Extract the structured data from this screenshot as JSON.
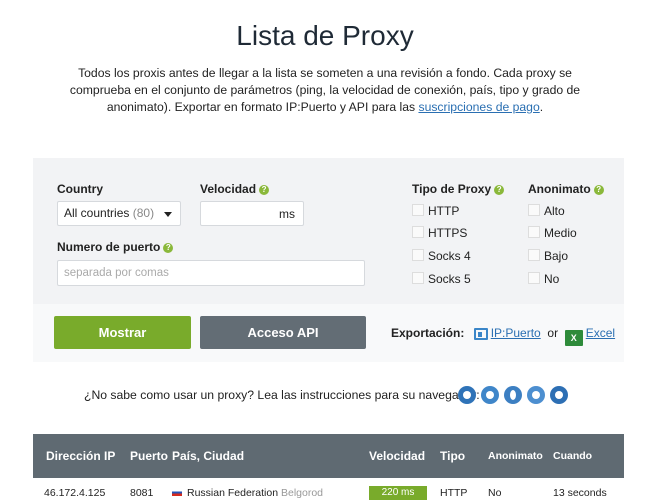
{
  "page": {
    "title": "Lista de Proxy",
    "intro_text": "Todos los proxis antes de llegar a la lista se someten a una revisión a fondo. Cada proxy se comprueba en el conjunto de parámetros (ping, la velocidad de conexión, país, tipo y grado de anonimato). Exportar en formato IP:Puerto y API para las ",
    "intro_link": "suscripciones de pago",
    "intro_end": "."
  },
  "filters": {
    "country_label": "Country",
    "country_value": "All countries",
    "country_count": "(80)",
    "speed_label": "Velocidad",
    "speed_unit": "ms",
    "port_label": "Numero de puerto",
    "port_placeholder": "separada por comas",
    "type_label": "Tipo de Proxy",
    "types": [
      "HTTP",
      "HTTPS",
      "Socks 4",
      "Socks 5"
    ],
    "anon_label": "Anonimato",
    "anon": [
      "Alto",
      "Medio",
      "Bajo",
      "No"
    ]
  },
  "actions": {
    "show_label": "Mostrar",
    "api_label": "Acceso API",
    "export_label": "Exportación:",
    "export_ip": "IP:Puerto",
    "export_or": "or",
    "export_excel": "Excel",
    "excel_icon_text": "X"
  },
  "browser_help": "¿No sabe como usar un proxy? Lea las instrucciones para su navegador:",
  "browser_icons": [
    "chrome-icon",
    "firefox-icon",
    "opera-icon",
    "safari-icon",
    "ie-icon"
  ],
  "table": {
    "headers": [
      "Dirección IP",
      "Puerto",
      "País, Ciudad",
      "Velocidad",
      "Tipo",
      "Anonimato",
      "Cuando"
    ],
    "rows": [
      {
        "ip": "46.172.4.125",
        "port": "8081",
        "country": "Russian Federation",
        "city": "Belgorod",
        "speed": "220 ms",
        "type": "HTTP",
        "anon": "No",
        "when": "13 seconds"
      }
    ]
  },
  "colors": {
    "accent_green": "#79ab2b",
    "gray_button": "#636d75",
    "link_blue": "#2a6fb2",
    "header_gray": "#5f6a72"
  }
}
